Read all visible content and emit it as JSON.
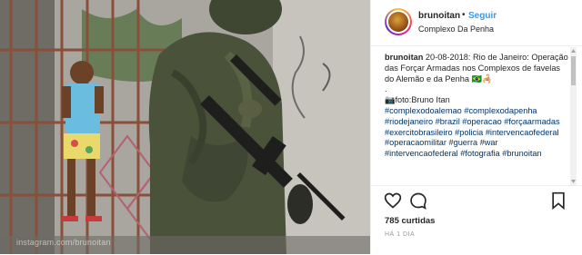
{
  "photo": {
    "alt_watermark": "instagram.com/brunoitan"
  },
  "header": {
    "username": "brunoitan",
    "separator": "•",
    "follow_label": "Seguir",
    "location": "Complexo Da Penha"
  },
  "caption": {
    "author": "brunoitan",
    "text": "20-08-2018: Rio de Janeiro: Operação das Forçar Armadas nos Complexos de favelas do Alemão e da Penha 🇧🇷🦂",
    "dot_line": ".",
    "credit": "📷foto:Bruno Itan",
    "hashtags": "#complexodoalemao #complexodapenha #riodejaneiro #brazil #operacao #forçaarmadas #exercitobrasileiro #policia #intervencaofederal #operacaomilitar #guerra #war #intervencaofederal #fotografia #brunoitan"
  },
  "actions": {
    "like_icon": "heart-icon",
    "comment_icon": "comment-icon",
    "save_icon": "bookmark-icon",
    "likes": "785 curtidas",
    "time_ago": "HÁ 1 DIA"
  },
  "colors": {
    "link": "#3897f0",
    "hashtag": "#003569",
    "text": "#262626",
    "muted": "#999999"
  }
}
